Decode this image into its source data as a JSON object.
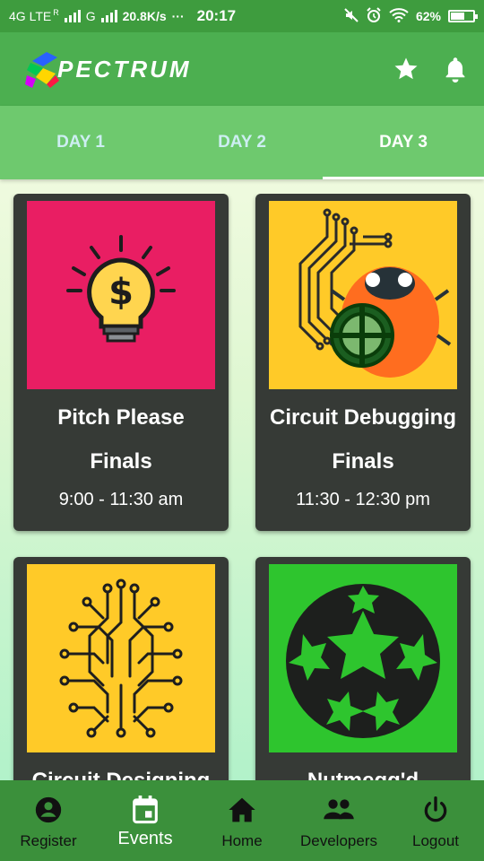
{
  "status_bar": {
    "network1": "4G LTE",
    "roaming": "R",
    "network2": "G",
    "speed": "20.8K/s",
    "dots": "···",
    "time": "20:17",
    "battery": "62%",
    "battery_level": 0.62
  },
  "app_bar": {
    "logo_text": "PECTRUM",
    "actions": [
      "star-icon",
      "bell-icon"
    ]
  },
  "tabs": {
    "items": [
      {
        "label": "DAY 1",
        "active": false
      },
      {
        "label": "DAY 2",
        "active": false
      },
      {
        "label": "DAY 3",
        "active": true
      }
    ]
  },
  "events": [
    {
      "title_line1": "Pitch Please",
      "title_line2": "Finals",
      "time": "9:00 - 11:30 am",
      "image": "lightbulb-dollar-icon",
      "bg": "#e91e63"
    },
    {
      "title_line1": "Circuit Debugging",
      "title_line2": "Finals",
      "time": "11:30 - 12:30 pm",
      "image": "bug-circuit-icon",
      "bg": "#ffca28"
    },
    {
      "title_line1": "Circuit Designing",
      "title_line2": "",
      "time": "",
      "image": "circuit-brain-icon",
      "bg": "#ffca28"
    },
    {
      "title_line1": "Nutmegg'd",
      "title_line2": "",
      "time": "",
      "image": "football-icon",
      "bg": "#2ec52e"
    }
  ],
  "bottom_nav": {
    "items": [
      {
        "label": "Register",
        "icon": "account-circle-icon",
        "active": false
      },
      {
        "label": "Events",
        "icon": "calendar-icon",
        "active": true
      },
      {
        "label": "Home",
        "icon": "home-icon",
        "active": false
      },
      {
        "label": "Developers",
        "icon": "people-icon",
        "active": false
      },
      {
        "label": "Logout",
        "icon": "power-icon",
        "active": false
      }
    ]
  },
  "colors": {
    "status_bar": "#3e9c3e",
    "app_bar": "#4caf50",
    "tab_bar": "#6ec96e",
    "card": "#363a36",
    "bottom_nav": "#3b903b"
  }
}
